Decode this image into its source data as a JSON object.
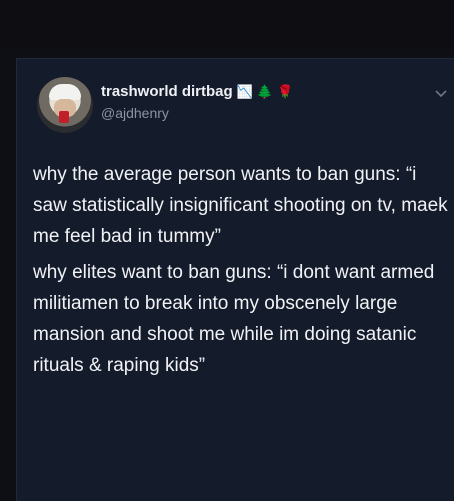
{
  "user": {
    "display_name": "trashworld dirtbag",
    "handle": "@ajdhenry",
    "emojis": [
      "📉",
      "🌲",
      "🌹"
    ]
  },
  "tweet": {
    "paragraphs": [
      "why the average person wants to ban guns: “i saw statistically insignificant shooting on tv, maek me feel bad in tummy”",
      "why elites want to ban guns: “i dont want armed militiamen to break into my obscenely large mansion and shoot me while im doing satanic rituals & raping kids”"
    ]
  },
  "icons": {
    "menu": "chevron-down-icon"
  },
  "colors": {
    "card_background": "#141b2b",
    "text": "#f1f2f5",
    "handle": "#8c94a3"
  }
}
